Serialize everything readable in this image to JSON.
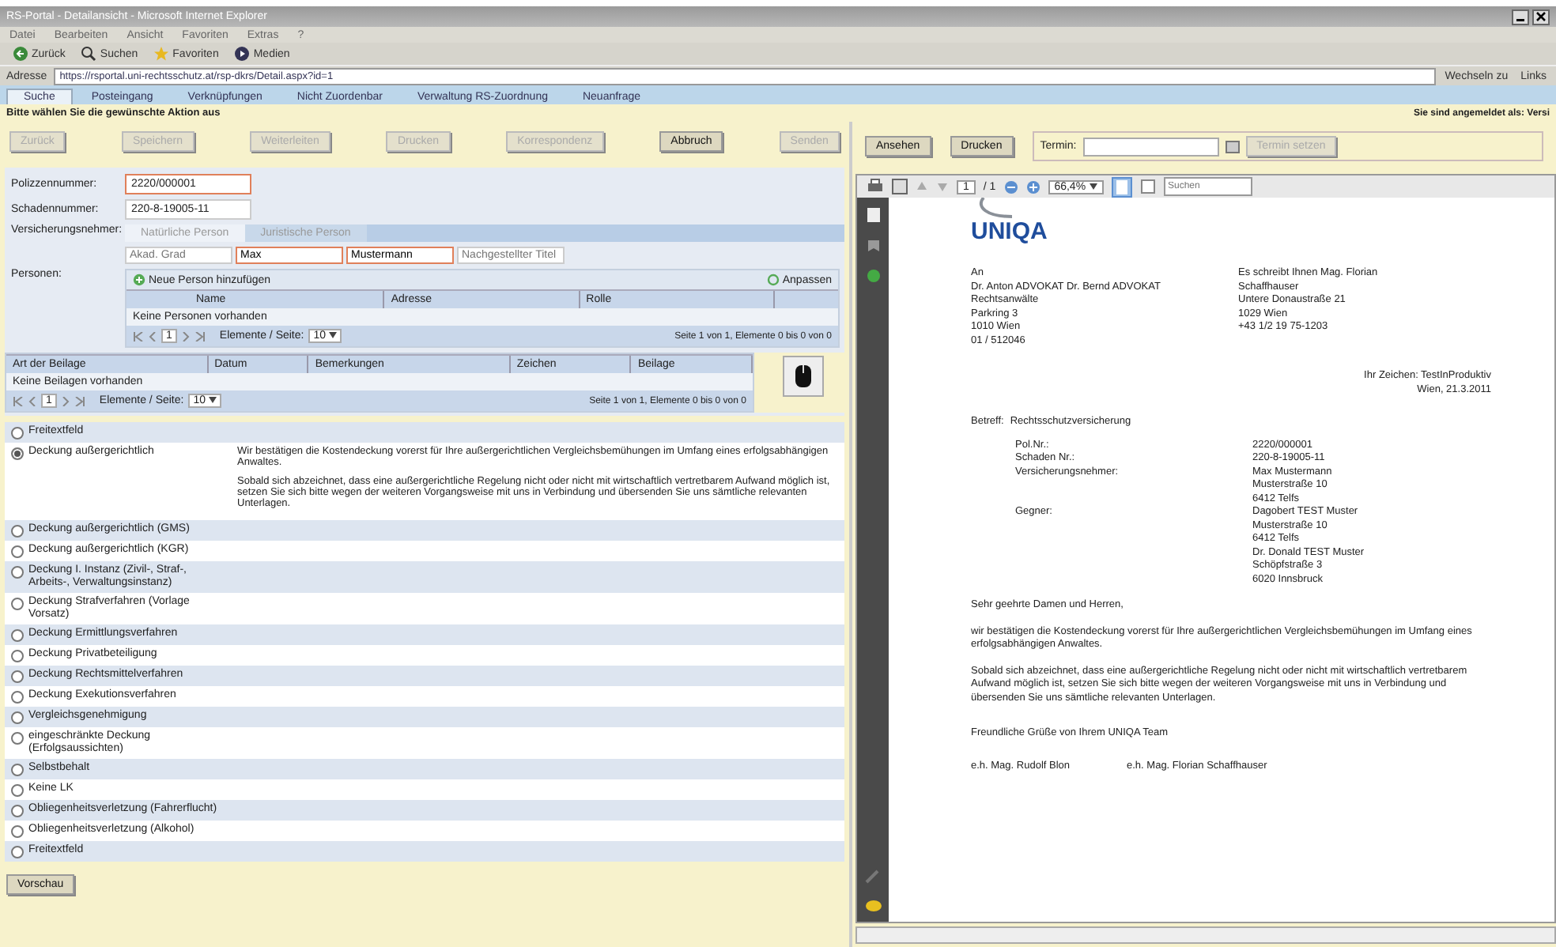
{
  "window": {
    "title": "RS-Portal - Detailansicht - Microsoft Internet Explorer"
  },
  "menu": [
    "Datei",
    "Bearbeiten",
    "Ansicht",
    "Favoriten",
    "Extras",
    "?"
  ],
  "toolbar": [
    {
      "label": "Zurück",
      "kind": "back"
    },
    {
      "label": "Suchen",
      "kind": "search"
    },
    {
      "label": "Favoriten",
      "kind": "star"
    },
    {
      "label": "Medien",
      "kind": "media"
    }
  ],
  "address": {
    "label": "Adresse",
    "url": "https://rsportal.uni-rechtsschutz.at/rsp-dkrs/Detail.aspx?id=1",
    "go": "Wechseln zu",
    "links": "Links"
  },
  "tabs": [
    {
      "label": "Suche",
      "selected": true
    },
    {
      "label": "Posteingang",
      "selected": false
    },
    {
      "label": "Verknüpfungen",
      "selected": false
    },
    {
      "label": "Nicht Zuordenbar",
      "selected": false
    },
    {
      "label": "Verwaltung RS-Zuordnung",
      "selected": false
    },
    {
      "label": "Neuanfrage",
      "selected": false
    }
  ],
  "instruction": "Bitte wählen Sie die gewünschte Aktion aus",
  "user_info": "Sie sind angemeldet als: Versi",
  "actions": [
    {
      "label": "Zurück",
      "disabled": true
    },
    {
      "label": "Speichern",
      "disabled": true
    },
    {
      "label": "Weiterleiten",
      "disabled": true
    },
    {
      "label": "Drucken",
      "disabled": true
    },
    {
      "label": "Korrespondenz",
      "disabled": true
    },
    {
      "label": "Abbruch",
      "disabled": false
    },
    {
      "label": "Senden",
      "disabled": true
    }
  ],
  "right_actions": [
    {
      "label": "Ansehen",
      "disabled": false
    },
    {
      "label": "Drucken",
      "disabled": false
    }
  ],
  "termin": {
    "label": "Termin:",
    "button": "Termin setzen"
  },
  "form": {
    "policy_label": "Polizzennummer:",
    "policy": "2220/000001",
    "claim_label": "Schadennummer:",
    "claim": "220-8-19005-11",
    "holder_label": "Versicherungsnehmer:",
    "person_types": [
      {
        "label": "Natürliche Person",
        "selected": true
      },
      {
        "label": "Juristische Person",
        "selected": false
      }
    ],
    "title_placeholder": "Akad. Grad",
    "first_name": "Max",
    "last_name": "Mustermann",
    "suffix_placeholder": "Nachgestellter Titel"
  },
  "persons": {
    "label": "Personen:",
    "add": "Neue Person hinzufügen",
    "adjust": "Anpassen",
    "columns": [
      "Name",
      "Adresse",
      "Rolle"
    ],
    "empty": "Keine Personen vorhanden",
    "page_size_label": "Elemente / Seite:",
    "page_size": "10",
    "page": "1",
    "summary": "Seite 1 von 1, Elemente 0 bis 0 von 0"
  },
  "attachments": {
    "columns": [
      "Art der Beilage",
      "Datum",
      "Bemerkungen",
      "Zeichen",
      "Beilage"
    ],
    "empty": "Keine Beilagen vorhanden",
    "page_size_label": "Elemente / Seite:",
    "page_size": "10",
    "page": "1",
    "summary": "Seite 1 von 1, Elemente 0 bis 0 von 0"
  },
  "options": [
    {
      "label": "Freitextfeld",
      "selected": false
    },
    {
      "label": "Deckung außergerichtlich",
      "selected": true,
      "description": [
        "Wir bestätigen die Kostendeckung vorerst für Ihre außergerichtlichen Vergleichsbemühungen im Umfang eines erfolgsabhängigen Anwaltes.",
        "Sobald sich abzeichnet, dass eine außergerichtliche Regelung nicht oder nicht mit wirtschaftlich vertretbarem Aufwand möglich ist, setzen Sie sich bitte wegen der weiteren Vorgangsweise mit uns in Verbindung und übersenden Sie uns sämtliche relevanten Unterlagen."
      ]
    },
    {
      "label": "Deckung außergerichtlich (GMS)",
      "selected": false
    },
    {
      "label": "Deckung außergerichtlich (KGR)",
      "selected": false
    },
    {
      "label": "Deckung I. Instanz (Zivil-, Straf-, Arbeits-, Verwaltungsinstanz)",
      "selected": false
    },
    {
      "label": "Deckung Strafverfahren (Vorlage Vorsatz)",
      "selected": false
    },
    {
      "label": "Deckung Ermittlungsverfahren",
      "selected": false
    },
    {
      "label": "Deckung Privatbeteiligung",
      "selected": false
    },
    {
      "label": "Deckung Rechtsmittelverfahren",
      "selected": false
    },
    {
      "label": "Deckung Exekutionsverfahren",
      "selected": false
    },
    {
      "label": "Vergleichsgenehmigung",
      "selected": false
    },
    {
      "label": "eingeschränkte Deckung (Erfolgsaussichten)",
      "selected": false
    },
    {
      "label": "Selbstbehalt",
      "selected": false
    },
    {
      "label": "Keine LK",
      "selected": false
    },
    {
      "label": "Obliegenheitsverletzung (Fahrerflucht)",
      "selected": false
    },
    {
      "label": "Obliegenheitsverletzung (Alkohol)",
      "selected": false
    },
    {
      "label": "Freitextfeld",
      "selected": false
    }
  ],
  "next_button": "Vorschau",
  "pdf": {
    "page": "1",
    "page_count": "/ 1",
    "zoom": "66,4%",
    "search_placeholder": "Suchen",
    "logo": "UNIQA",
    "recipient": [
      "An",
      "Dr. Anton ADVOKAT Dr. Bernd ADVOKAT",
      "Rechtsanwälte",
      "Parkring 3",
      "1010 Wien",
      "01 / 512046"
    ],
    "sender": [
      "Es schreibt Ihnen Mag. Florian",
      "Schaffhauser",
      "Untere Donaustraße 21",
      "1029 Wien",
      "+43 1/2 19 75-1203"
    ],
    "reference": "Ihr Zeichen: TestInProduktiv",
    "date": "Wien, 21.3.2011",
    "subject_label": "Betreff:",
    "subject": "Rechtsschutzversicherung",
    "facts": [
      {
        "label": "Pol.Nr.:",
        "lines": [
          "2220/000001"
        ]
      },
      {
        "label": "Schaden Nr.:",
        "lines": [
          "220-8-19005-11"
        ]
      },
      {
        "label": "Versicherungsnehmer:",
        "lines": [
          "Max Mustermann",
          "Musterstraße 10",
          "6412 Telfs"
        ]
      },
      {
        "label": "Gegner:",
        "lines": [
          "Dagobert TEST Muster",
          "Musterstraße 10",
          "6412 Telfs",
          "Dr. Donald TEST Muster",
          "Schöpfstraße 3",
          "6020 Innsbruck"
        ]
      }
    ],
    "salutation": "Sehr geehrte Damen und Herren,",
    "paragraphs": [
      "wir bestätigen die Kostendeckung vorerst für Ihre außergerichtlichen Vergleichsbemühungen im Umfang eines erfolgsabhängigen Anwaltes.",
      "Sobald sich abzeichnet, dass eine außergerichtliche Regelung nicht oder nicht mit wirtschaftlich vertretbarem Aufwand möglich ist, setzen Sie sich bitte wegen der weiteren Vorgangsweise mit uns in Verbindung und übersenden Sie uns sämtliche relevanten Unterlagen."
    ],
    "closing": "Freundliche Grüße von Ihrem UNIQA Team",
    "signatures": [
      "e.h. Mag. Rudolf Blon",
      "e.h. Mag. Florian Schaffhauser"
    ]
  }
}
